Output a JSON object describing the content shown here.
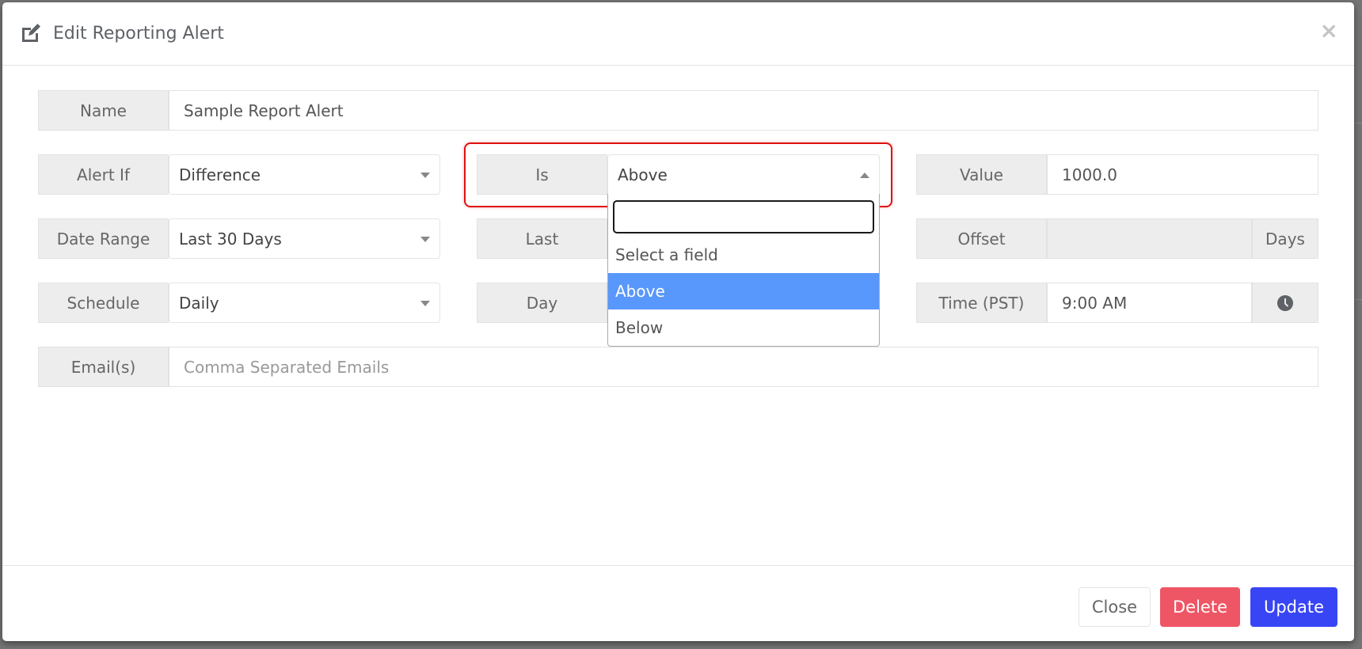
{
  "modal": {
    "title": "Edit Reporting Alert",
    "title_icon": "edit-icon",
    "close_icon": "close-icon",
    "close_glyph": "×"
  },
  "form": {
    "name": {
      "label": "Name",
      "value": "Sample Report Alert"
    },
    "alert_if": {
      "label": "Alert If",
      "value": "Difference"
    },
    "is": {
      "label": "Is",
      "value": "Above",
      "open": true
    },
    "value": {
      "label": "Value",
      "value": "1000.0"
    },
    "date_range": {
      "label": "Date Range",
      "value": "Last 30 Days"
    },
    "last": {
      "label": "Last"
    },
    "offset": {
      "label": "Offset",
      "value": "",
      "suffix": "Days"
    },
    "schedule": {
      "label": "Schedule",
      "value": "Daily"
    },
    "day": {
      "label": "Day"
    },
    "time": {
      "label": "Time (PST)",
      "value": "9:00 AM",
      "icon": "clock-icon"
    },
    "emails": {
      "label": "Email(s)",
      "value": "",
      "placeholder": "Comma Separated Emails"
    }
  },
  "is_dropdown": {
    "search_value": "",
    "options": [
      {
        "label": "Select a field",
        "highlighted": false
      },
      {
        "label": "Above",
        "highlighted": true
      },
      {
        "label": "Below",
        "highlighted": false
      }
    ]
  },
  "footer": {
    "close_label": "Close",
    "delete_label": "Delete",
    "update_label": "Update"
  },
  "colors": {
    "highlight_outline": "#e01010",
    "option_highlight": "#5897fb",
    "delete_button": "#ef5665",
    "update_button": "#3845f5",
    "addon_background": "#ededed"
  }
}
